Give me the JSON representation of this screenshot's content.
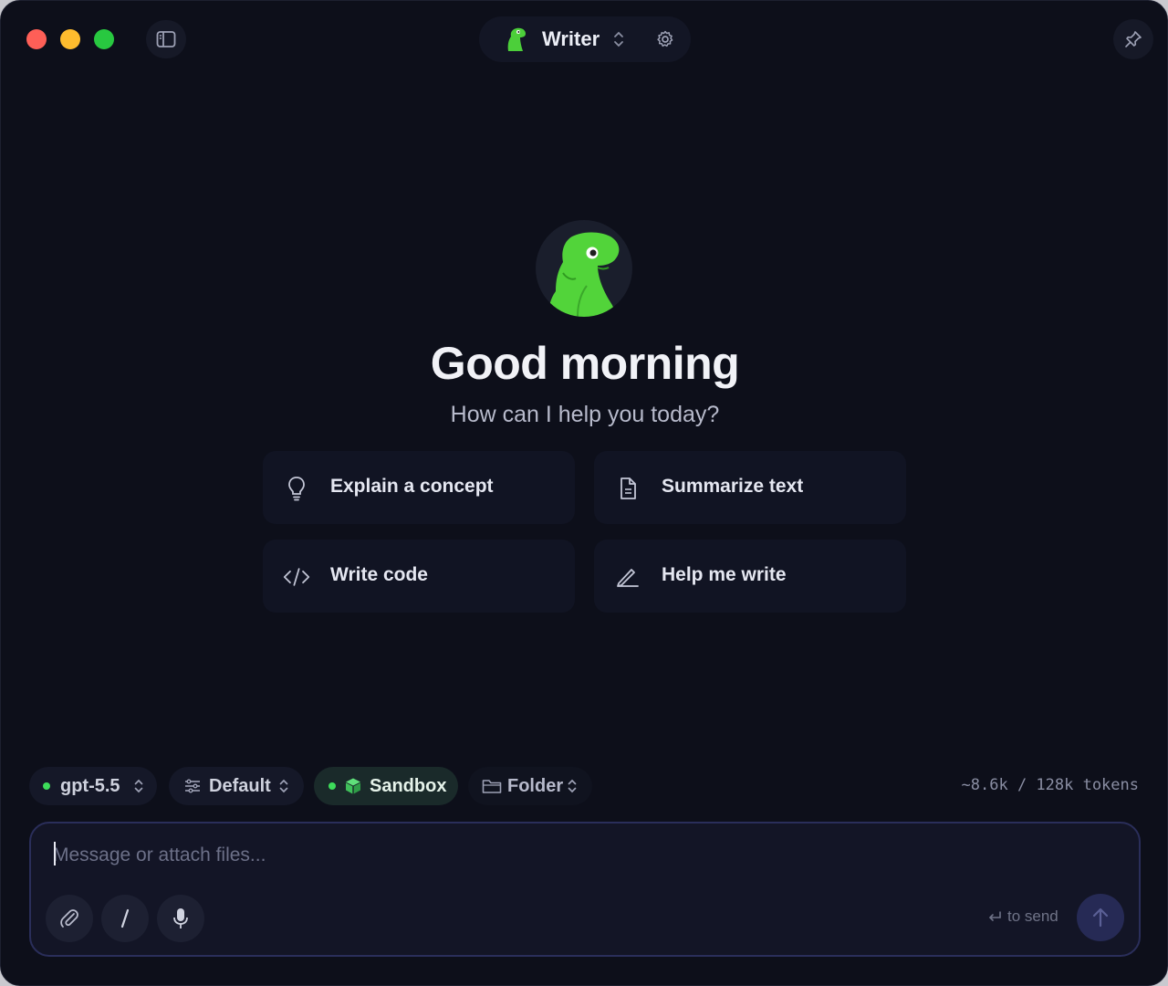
{
  "header": {
    "title": "Writer",
    "icons": [
      "sidebar-icon",
      "chevron-updown-icon",
      "gear-icon",
      "pin-icon"
    ]
  },
  "hero": {
    "greeting": "Good morning",
    "subtitle": "How can I help you today?"
  },
  "suggestions": [
    {
      "label": "Explain a concept",
      "icon": "lightbulb-icon"
    },
    {
      "label": "Summarize text",
      "icon": "document-icon"
    },
    {
      "label": "Write code",
      "icon": "code-icon"
    },
    {
      "label": "Help me write",
      "icon": "pen-icon"
    }
  ],
  "toolbar": {
    "model": "gpt-5.5",
    "preset": "Default",
    "environment": "Sandbox",
    "folder": "Folder",
    "tokens": "~8.6k / 128k tokens"
  },
  "composer": {
    "placeholder": "Message or attach files...",
    "send_hint": "to send"
  },
  "colors": {
    "background": "#0d0f1a",
    "accent_green": "#3ddc5a",
    "send_button": "#262a55"
  }
}
